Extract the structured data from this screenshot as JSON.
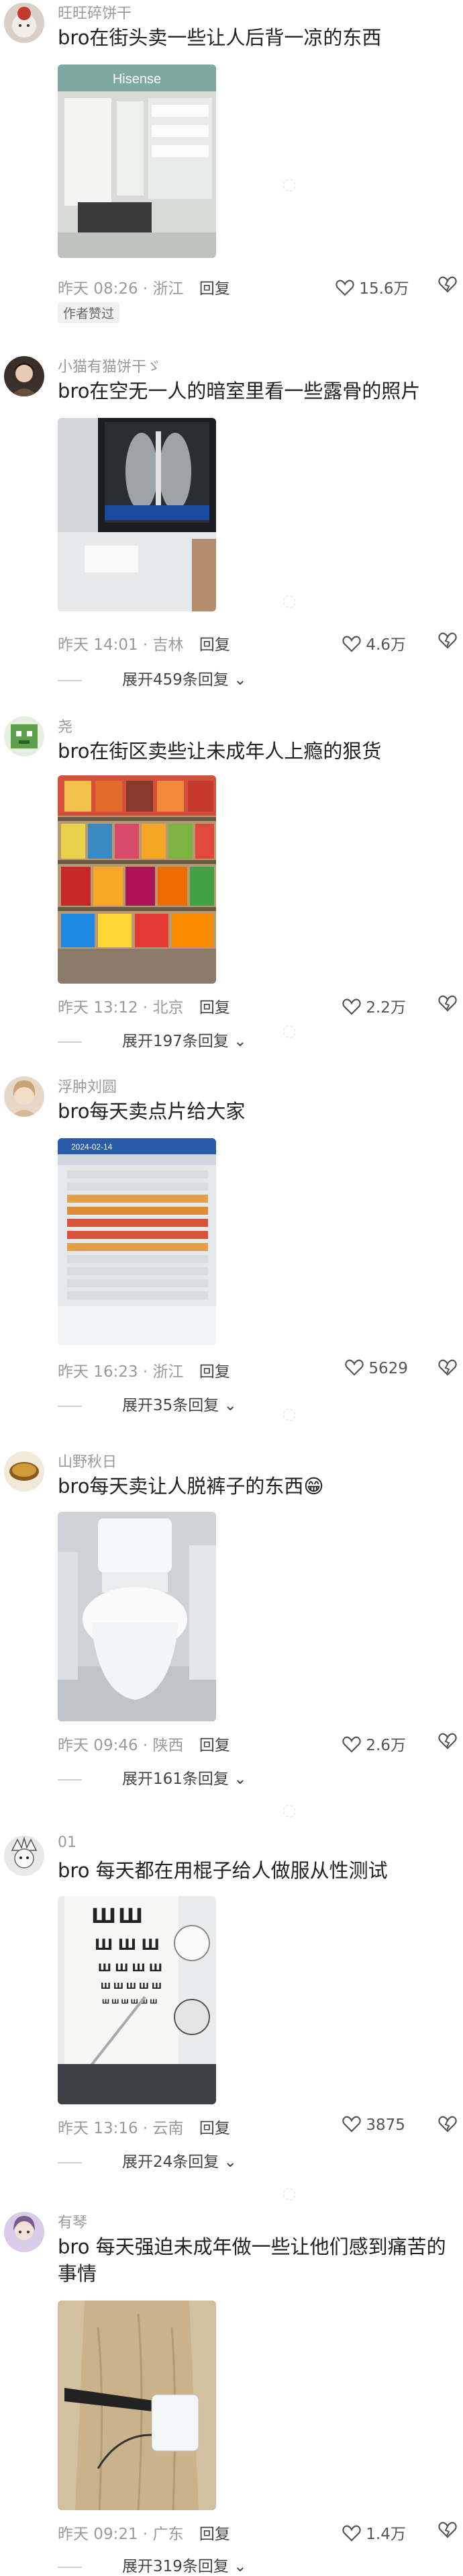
{
  "comments": [
    {
      "username": "旺旺碎饼干",
      "text": "bro在街头卖一些让人后背一凉的东西",
      "time": "昨天 08:26",
      "location": "浙江",
      "reply": "回复",
      "likes": "15.6万",
      "tag": "作者赞过",
      "avatar_icon": "avatar-icon"
    },
    {
      "username": "小猫有猫饼干ゞ",
      "text": "bro在空无一人的暗室里看一些露骨的照片",
      "time": "昨天 14:01",
      "location": "吉林",
      "reply": "回复",
      "likes": "4.6万",
      "expand": "展开459条回复",
      "avatar_icon": "avatar-icon"
    },
    {
      "username": "尧",
      "text": "bro在街区卖些让未成年人上瘾的狠货",
      "time": "昨天 13:12",
      "location": "北京",
      "reply": "回复",
      "likes": "2.2万",
      "expand": "展开197条回复",
      "avatar_icon": "avatar-icon"
    },
    {
      "username": "浮肿刘圆",
      "text": "bro每天卖点片给大家",
      "time": "昨天 16:23",
      "location": "浙江",
      "reply": "回复",
      "likes": "5629",
      "expand": "展开35条回复",
      "avatar_icon": "avatar-icon"
    },
    {
      "username": "山野秋日",
      "text": "bro每天卖让人脱裤子的东西😁",
      "time": "昨天 09:46",
      "location": "陕西",
      "reply": "回复",
      "likes": "2.6万",
      "expand": "展开161条回复",
      "avatar_icon": "avatar-icon"
    },
    {
      "username": "01",
      "text": "bro 每天都在用棍子给人做服从性测试",
      "time": "昨天 13:16",
      "location": "云南",
      "reply": "回复",
      "likes": "3875",
      "expand": "展开24条回复",
      "avatar_icon": "avatar-icon"
    },
    {
      "username": "有琴",
      "text": "bro 每天强迫未成年做一些让他们感到痛苦的事情",
      "time": "昨天 09:21",
      "location": "广东",
      "reply": "回复",
      "likes": "1.4万",
      "expand": "展开319条回复",
      "avatar_icon": "avatar-icon"
    }
  ],
  "photos": {
    "store_sign": "Hisense",
    "ticket_header": "2024-02-14"
  },
  "colors": {
    "meta_gray": "#9a9a9a",
    "text": "#222222",
    "background": "#ffffff"
  }
}
